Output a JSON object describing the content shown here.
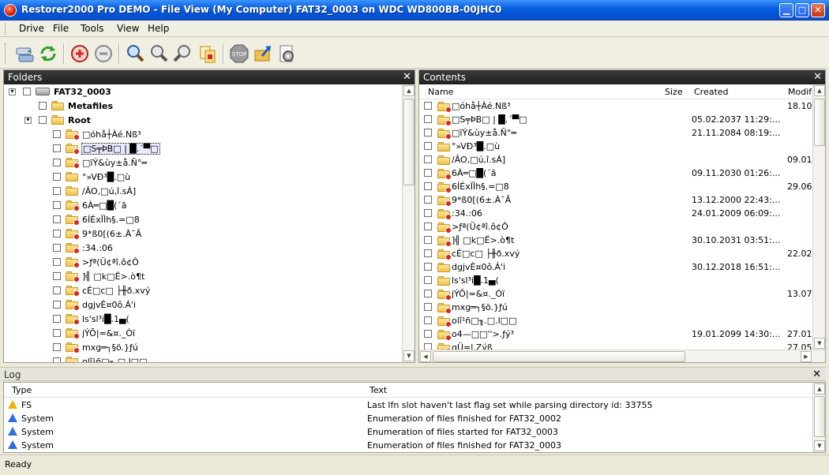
{
  "window": {
    "title": "Restorer2000 Pro DEMO - File View (My Computer) FAT32_0003 on WDC WD800BB-00JHC0",
    "minimize": "▁",
    "maximize": "□",
    "close": "✕"
  },
  "menu": [
    "Drive",
    "File",
    "Tools",
    "View",
    "Help"
  ],
  "toolbar_icons": [
    "drive-list-icon",
    "refresh-icon",
    "mark-icon",
    "unmark-icon",
    "find-icon",
    "find-next-icon",
    "find-prev-icon",
    "copy-icon",
    "stop-icon",
    "recover-icon",
    "settings-icon"
  ],
  "folders_pane": {
    "title": "Folders",
    "close": "✕",
    "tree": [
      {
        "label": "FAT32_0003",
        "level": 0,
        "type": "drive",
        "expander": "▾",
        "bold": true
      },
      {
        "label": "Metafiles",
        "level": 1,
        "type": "folder",
        "bold": true
      },
      {
        "label": "Root",
        "level": 1,
        "type": "folder",
        "expander": "▾",
        "bold": true
      },
      {
        "label": "□óhå┼Àé.Nß³",
        "level": 2,
        "type": "deleted"
      },
      {
        "label": "□S╤ÞB□ | █.´▀□",
        "level": 2,
        "type": "deleted",
        "selected": true
      },
      {
        "label": "□ïÝ&ùy±å.Ñ°═",
        "level": 2,
        "type": "deleted"
      },
      {
        "label": "°»VÐ³█.□ù",
        "level": 2,
        "type": "folder"
      },
      {
        "label": "/ÂO,□ú,î.sÁ]",
        "level": 2,
        "type": "folder"
      },
      {
        "label": "6À═□█(´ã",
        "level": 2,
        "type": "deleted"
      },
      {
        "label": "6ÍÉxÏÌh§.=□8",
        "level": 2,
        "type": "deleted"
      },
      {
        "label": "9*ß0[(6±.À¯Â",
        "level": 2,
        "type": "deleted"
      },
      {
        "label": ":34.:06",
        "level": 2,
        "type": "deleted"
      },
      {
        "label": ">ƒª(Ü¢ªî.ô¢Ô",
        "level": 2,
        "type": "deleted"
      },
      {
        "label": "]╣ □k□Ë>.ò¶t",
        "level": 2,
        "type": "deleted"
      },
      {
        "label": "cÉ□c□ ├╫ð.xvý",
        "level": 2,
        "type": "deleted"
      },
      {
        "label": "dgjvÈ¤0ô.Á'i",
        "level": 2,
        "type": "deleted"
      },
      {
        "label": "ls'sl³i█.1▄(",
        "level": 2,
        "type": "deleted"
      },
      {
        "label": "jÝÕ|=&¤._Òï",
        "level": 2,
        "type": "deleted"
      },
      {
        "label": "mxg═┐§ö.}ƒú",
        "level": 2,
        "type": "deleted"
      },
      {
        "label": "olî¹ñ□╖.□.l□□",
        "level": 2,
        "type": "deleted"
      }
    ]
  },
  "contents_pane": {
    "title": "Contents",
    "close": "✕",
    "columns": {
      "name": "Name",
      "size": "Size",
      "created": "Created",
      "modified": "Modif"
    },
    "rows": [
      {
        "name": "□óhå┼Àé.Nß³",
        "deleted": true,
        "created": "",
        "modified": "18.10."
      },
      {
        "name": "□S╤ÞB□ | █.´▀□",
        "deleted": true,
        "created": "05.02.2037 11:29:...",
        "modified": ""
      },
      {
        "name": "□ïÝ&ùy±å.Ñ°═",
        "deleted": true,
        "created": "21.11.2084 08:19:...",
        "modified": ""
      },
      {
        "name": "°»VÐ³█.□ù",
        "deleted": false,
        "created": "",
        "modified": ""
      },
      {
        "name": "/ÂO,□ú,î.sÁ]",
        "deleted": false,
        "created": "",
        "modified": "09.01."
      },
      {
        "name": "6À═□█(´ã",
        "deleted": true,
        "created": "09.11.2030 01:26:...",
        "modified": ""
      },
      {
        "name": "6ÍÉxÏÌh§.=□8",
        "deleted": true,
        "created": "",
        "modified": "29.06."
      },
      {
        "name": "9*ß0[(6±.À¯Â",
        "deleted": true,
        "created": "13.12.2000 22:43:...",
        "modified": ""
      },
      {
        "name": ":34.:06",
        "deleted": true,
        "created": "24.01.2009 06:09:...",
        "modified": ""
      },
      {
        "name": ">ƒª(Ü¢ªî.ô¢Ô",
        "deleted": true,
        "created": "",
        "modified": ""
      },
      {
        "name": "]╣ □k□Ë>.ò¶t",
        "deleted": true,
        "created": "30.10.2031 03:51:...",
        "modified": ""
      },
      {
        "name": "cÉ□c□ ├╫ð.xvý",
        "deleted": true,
        "created": "",
        "modified": "22.02."
      },
      {
        "name": "dgjvÈ¤0ô.Á'i",
        "deleted": false,
        "created": "30.12.2018 16:51:...",
        "modified": ""
      },
      {
        "name": "ls'sl³i█.1▄(",
        "deleted": false,
        "created": "",
        "modified": ""
      },
      {
        "name": "jÝÕ|=&¤._Òï",
        "deleted": true,
        "created": "",
        "modified": "13.07."
      },
      {
        "name": "mxg═┐§ö.}ƒú",
        "deleted": true,
        "created": "",
        "modified": ""
      },
      {
        "name": "olî¹ñ□╖.□.l□□",
        "deleted": true,
        "created": "",
        "modified": ""
      },
      {
        "name": "o4—□□''>.ƒý³",
        "deleted": true,
        "created": "19.01.2099 14:30:...",
        "modified": "27.01."
      },
      {
        "name": "qÜ=l.Zýß",
        "deleted": true,
        "created": "",
        "modified": "27.05."
      }
    ]
  },
  "log": {
    "title": "Log",
    "close": "✕",
    "columns": {
      "type": "Type",
      "text": "Text"
    },
    "rows": [
      {
        "type": "FS",
        "level": "warning",
        "text": "Last lfn slot haven't last flag set while parsing directory id: 33755"
      },
      {
        "type": "System",
        "level": "info",
        "text": "Enumeration of files finished for FAT32_0002"
      },
      {
        "type": "System",
        "level": "info",
        "text": "Enumeration of files started for FAT32_0003"
      },
      {
        "type": "System",
        "level": "info",
        "text": "Enumeration of files finished for FAT32_0003"
      }
    ]
  },
  "status": "Ready",
  "colors": {
    "title_bar": "#0454d8",
    "pane_header": "#2a2a2a",
    "deleted_badge": "#d7261e",
    "folder": "#f0c04a"
  }
}
